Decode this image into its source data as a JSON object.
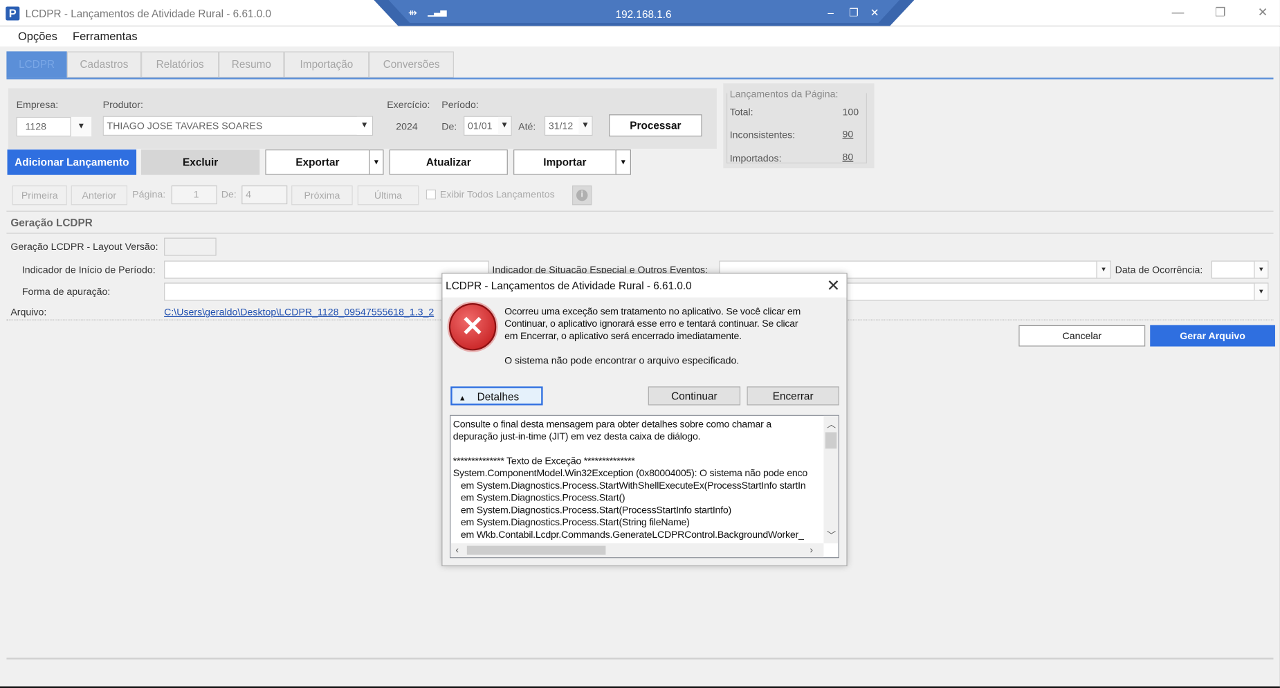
{
  "window": {
    "title": "LCDPR - Lançamentos de Atividade Rural - 6.61.0.0",
    "app_icon_letter": "P",
    "controls": {
      "minimize": "—",
      "restore": "❐",
      "close": "✕"
    }
  },
  "remote_bar": {
    "ip": "192.168.1.6",
    "pin": "⇻",
    "signal": "▁▃▅",
    "minimize": "–",
    "restore": "❐",
    "close": "✕"
  },
  "menu": [
    "Opções",
    "Ferramentas"
  ],
  "tabs": [
    "LCDPR",
    "Cadastros",
    "Relatórios",
    "Resumo",
    "Importação",
    "Conversões"
  ],
  "filters": {
    "empresa_label": "Empresa:",
    "empresa_value": "1128",
    "produtor_label": "Produtor:",
    "produtor_value": "THIAGO JOSE TAVARES SOARES",
    "exercicio_label": "Exercício:",
    "exercicio_value": "2024",
    "periodo_label": "Período:",
    "de_label": "De:",
    "de_value": "01/01",
    "ate_label": "Até:",
    "ate_value": "31/12",
    "processar": "Processar"
  },
  "summary": {
    "title": "Lançamentos da Página:",
    "total_label": "Total:",
    "total_value": "100",
    "inconsistentes_label": "Inconsistentes:",
    "inconsistentes_value": "90",
    "importados_label": "Importados:",
    "importados_value": "80"
  },
  "actions": {
    "adicionar": "Adicionar Lançamento",
    "excluir": "Excluir",
    "exportar": "Exportar",
    "atualizar": "Atualizar",
    "importar": "Importar"
  },
  "pager": {
    "primeira": "Primeira",
    "anterior": "Anterior",
    "pagina_label": "Página:",
    "pagina_value": "1",
    "de_label": "De:",
    "de_value": "4",
    "proxima": "Próxima",
    "ultima": "Última",
    "exibir_todos": "Exibir Todos Lançamentos"
  },
  "geracao": {
    "section_title": "Geração LCDPR",
    "layout_versao_label": "Geração LCDPR - Layout Versão:",
    "indicador_inicio_label": "Indicador de Início de Período:",
    "indicador_situacao_label": "Indicador de Situação Especial e Outros Eventos:",
    "data_ocorrencia_label": "Data de Ocorrência:",
    "forma_apuracao_label": "Forma de apuração:",
    "arquivo_label": "Arquivo:",
    "arquivo_path": "C:\\Users\\geraldo\\Desktop\\LCDPR_1128_09547555618_1.3_2",
    "cancelar": "Cancelar",
    "gerar_arquivo": "Gerar Arquivo"
  },
  "dialog": {
    "title": "LCDPR - Lançamentos de Atividade Rural - 6.61.0.0",
    "message_lines": [
      "Ocorreu uma exceção sem tratamento no aplicativo. Se você clicar em",
      "Continuar, o aplicativo ignorará esse erro e tentará continuar. Se clicar",
      "em Encerrar, o aplicativo será encerrado imediatamente."
    ],
    "detail_message": "O sistema não pode encontrar o arquivo especificado.",
    "detalhes": "Detalhes",
    "continuar": "Continuar",
    "encerrar": "Encerrar",
    "details_lines": [
      "Consulte o final desta mensagem para obter detalhes sobre como chamar a",
      "depuração just-in-time (JIT) em vez desta caixa de diálogo.",
      "",
      "************** Texto de Exceção **************",
      "System.ComponentModel.Win32Exception (0x80004005): O sistema não pode enco",
      "   em System.Diagnostics.Process.StartWithShellExecuteEx(ProcessStartInfo startIn",
      "   em System.Diagnostics.Process.Start()",
      "   em System.Diagnostics.Process.Start(ProcessStartInfo startInfo)",
      "   em System.Diagnostics.Process.Start(String fileName)",
      "   em Wkb.Contabil.Lcdpr.Commands.GenerateLCDPRControl.BackgroundWorker_"
    ]
  },
  "colors": {
    "accent_blue": "#2f6fe0",
    "error_red": "#d9262a",
    "remote_bar": "#3a66ad"
  }
}
